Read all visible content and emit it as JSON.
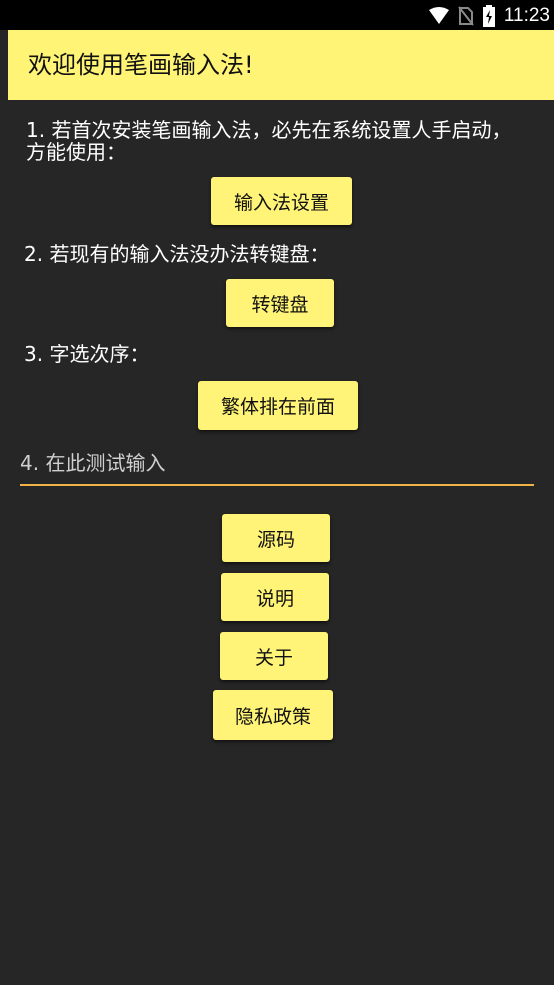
{
  "status_bar": {
    "time": "11:23",
    "icons": [
      "wifi-icon",
      "no-sim-icon",
      "battery-charging-icon"
    ]
  },
  "app_bar": {
    "title": "欢迎使用笔画输入法!"
  },
  "section1": {
    "line1": "1. 若首次安装笔画输入法，必先在系统设置人手启动，",
    "line2": "方能使用：",
    "button": "输入法设置"
  },
  "section2": {
    "text": "2. 若现有的输入法没办法转键盘：",
    "button": "转键盘"
  },
  "section3": {
    "text": "3. 字选次序：",
    "button": "繁体排在前面"
  },
  "section4": {
    "placeholder": "4. 在此测试输入",
    "value": ""
  },
  "bottom_buttons": {
    "source": "源码",
    "help": "说明",
    "about": "关于",
    "privacy": "隐私政策"
  },
  "colors": {
    "background": "#262626",
    "accent": "#fff475",
    "underline": "#f2b24a"
  }
}
